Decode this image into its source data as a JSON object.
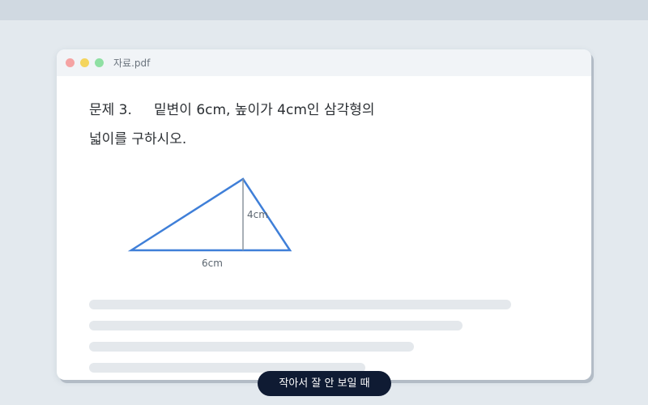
{
  "window": {
    "title": "자료.pdf"
  },
  "document": {
    "question_number": "문제 3.",
    "question_line1": "밑변이 6cm, 높이가 4cm인 삼각형의",
    "question_line2": "넓이를 구하시오.",
    "figure": {
      "height_label": "4cm",
      "base_label": "6cm",
      "stroke_color": "#3f7fd8"
    }
  },
  "caption": "작아서 잘 안 보일 때"
}
